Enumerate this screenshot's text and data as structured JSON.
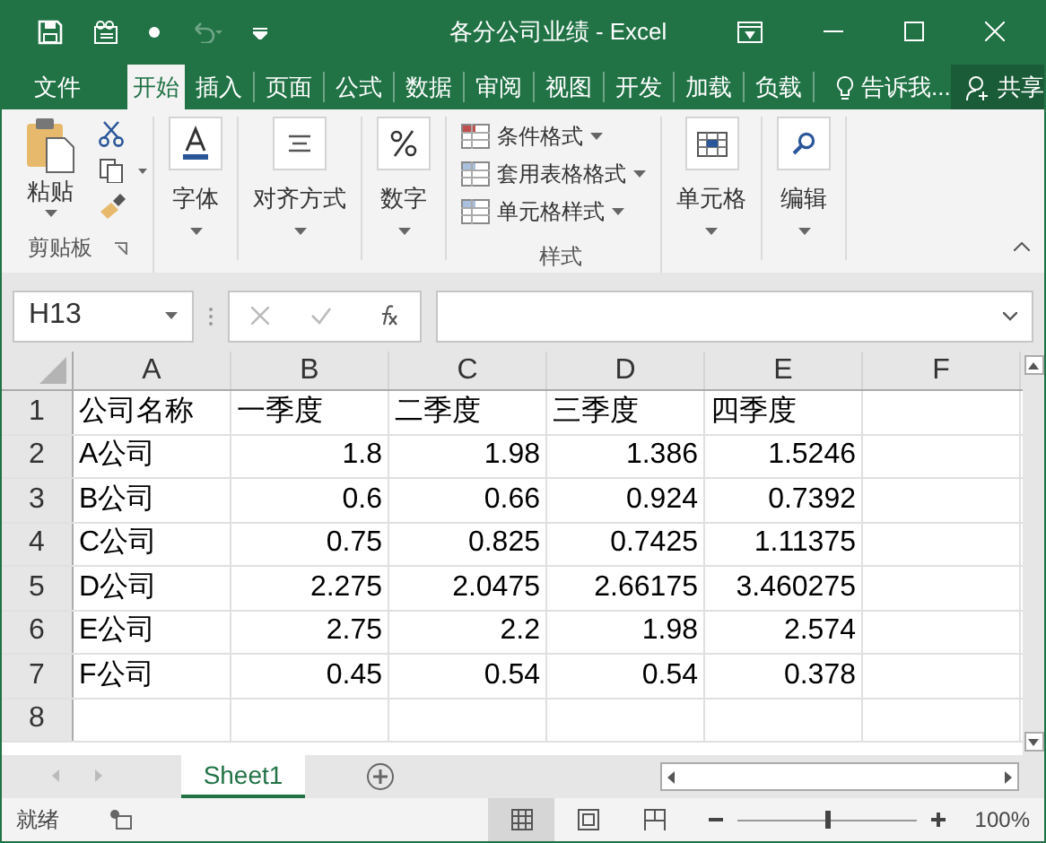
{
  "window": {
    "title": "各分公司业绩 - Excel"
  },
  "tabs": [
    {
      "label": "文件",
      "selected": false
    },
    {
      "label": "开始",
      "selected": true
    },
    {
      "label": "插入",
      "selected": false
    },
    {
      "label": "页面",
      "selected": false
    },
    {
      "label": "公式",
      "selected": false
    },
    {
      "label": "数据",
      "selected": false
    },
    {
      "label": "审阅",
      "selected": false
    },
    {
      "label": "视图",
      "selected": false
    },
    {
      "label": "开发",
      "selected": false
    },
    {
      "label": "加载",
      "selected": false
    },
    {
      "label": "负载",
      "selected": false
    }
  ],
  "tell_me": "告诉我...",
  "share": "共享",
  "ribbon": {
    "paste": "粘贴",
    "clipboard_label": "剪贴板",
    "big_buttons": [
      {
        "kind": "font",
        "label": "字体"
      },
      {
        "kind": "align",
        "label": "对齐方式"
      },
      {
        "kind": "number",
        "label": "数字"
      }
    ],
    "styles": [
      "条件格式",
      "套用表格格式",
      "单元格样式"
    ],
    "styles_label": "样式",
    "cells": "单元格",
    "editing": "编辑"
  },
  "name_box": "H13",
  "columns": [
    "A",
    "B",
    "C",
    "D",
    "E",
    "F"
  ],
  "rows": [
    {
      "header": "1",
      "cells": [
        "公司名称",
        "一季度",
        "二季度",
        "三季度",
        "四季度"
      ]
    },
    {
      "header": "2",
      "cells": [
        "A公司",
        "1.8",
        "1.98",
        "1.386",
        "1.5246"
      ]
    },
    {
      "header": "3",
      "cells": [
        "B公司",
        "0.6",
        "0.66",
        "0.924",
        "0.7392"
      ]
    },
    {
      "header": "4",
      "cells": [
        "C公司",
        "0.75",
        "0.825",
        "0.7425",
        "1.11375"
      ]
    },
    {
      "header": "5",
      "cells": [
        "D公司",
        "2.275",
        "2.0475",
        "2.66175",
        "3.460275"
      ]
    },
    {
      "header": "6",
      "cells": [
        "E公司",
        "2.75",
        "2.2",
        "1.98",
        "2.574"
      ]
    },
    {
      "header": "7",
      "cells": [
        "F公司",
        "0.45",
        "0.54",
        "0.54",
        "0.378"
      ]
    },
    {
      "header": "8",
      "cells": []
    }
  ],
  "sheets": [
    {
      "label": "Sheet1",
      "selected": true
    }
  ],
  "status": "就绪",
  "zoom": "100%",
  "zoom_slider": {
    "level": 0.5
  }
}
